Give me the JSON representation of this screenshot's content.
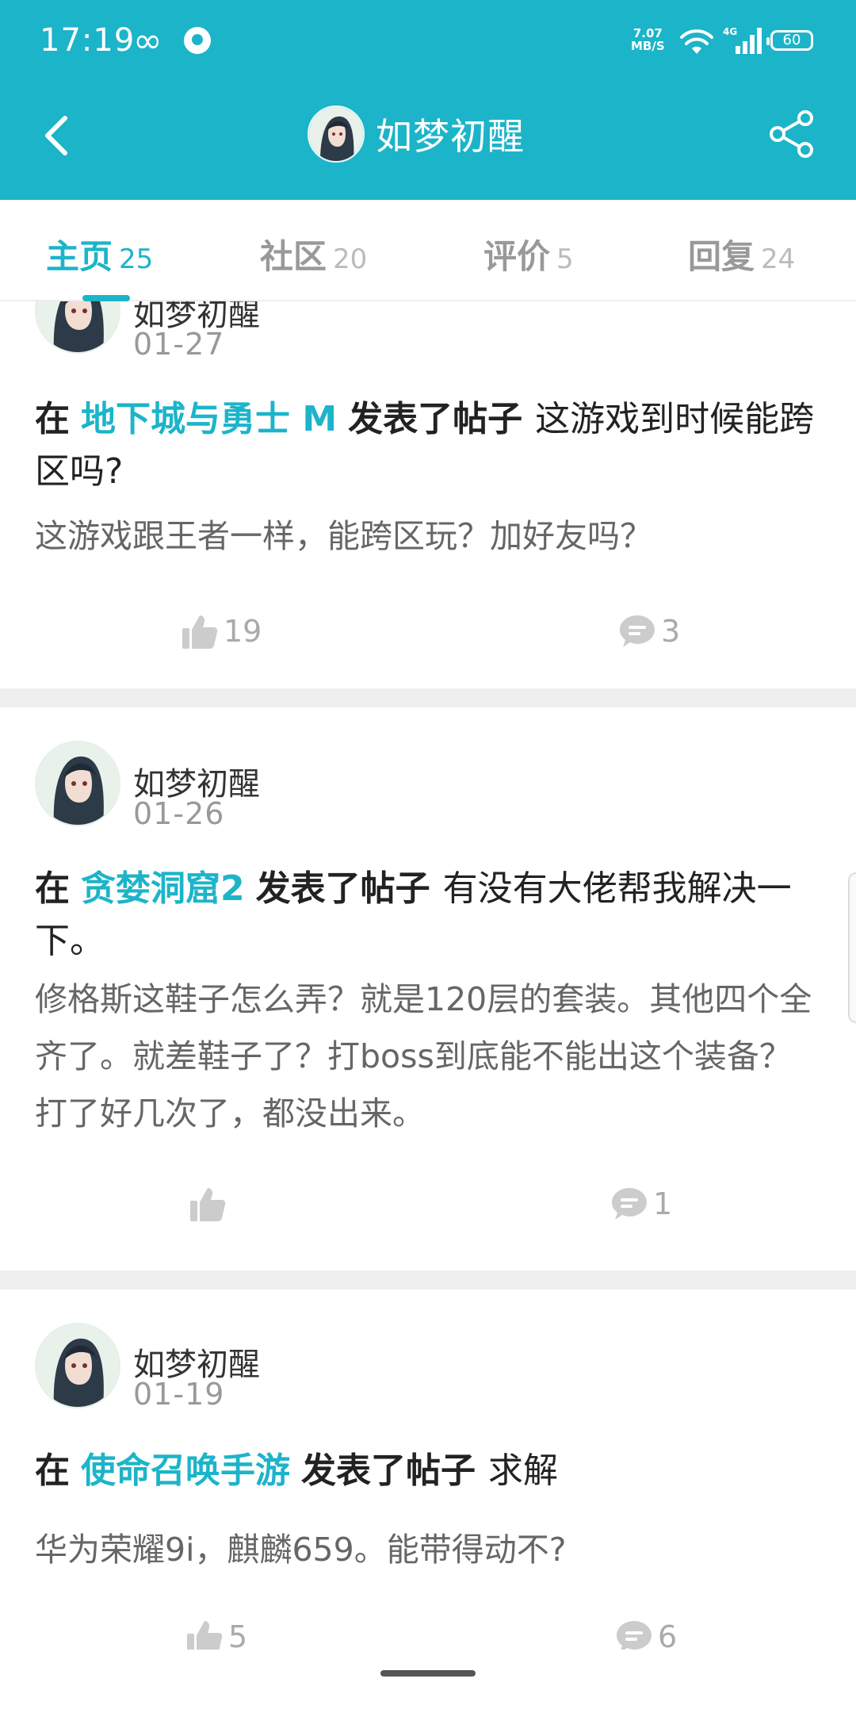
{
  "status_bar": {
    "time": "17:19",
    "net_speed_value": "7.07",
    "net_speed_unit": "MB/S",
    "network_type": "4G",
    "battery": "60"
  },
  "header": {
    "title": "如梦初醒",
    "back_icon": "chevron-left-icon",
    "share_icon": "share-icon"
  },
  "tabs": [
    {
      "label": "主页",
      "count": "25",
      "active": true
    },
    {
      "label": "社区",
      "count": "20",
      "active": false
    },
    {
      "label": "评价",
      "count": "5",
      "active": false
    },
    {
      "label": "回复",
      "count": "24",
      "active": false
    }
  ],
  "posts": [
    {
      "author": "如梦初醒",
      "date": "01-27",
      "prefix": "在",
      "game": "地下城与勇士 M",
      "action": "发表了帖子",
      "title": "这游戏到时候能跨区吗?",
      "excerpt": "这游戏跟王者一样，能跨区玩？加好友吗？",
      "likes": "19",
      "comments": "3"
    },
    {
      "author": "如梦初醒",
      "date": "01-26",
      "prefix": "在",
      "game": "贪婪洞窟2",
      "action": "发表了帖子",
      "title": "有没有大佬帮我解决一下。",
      "excerpt": "修格斯这鞋子怎么弄？就是120层的套装。其他四个全齐了。就差鞋子了？打boss到底能不能出这个装备？打了好几次了，都没出来。",
      "likes": "",
      "comments": "1"
    },
    {
      "author": "如梦初醒",
      "date": "01-19",
      "prefix": "在",
      "game": "使命召唤手游",
      "action": "发表了帖子",
      "title": "求解",
      "excerpt": "华为荣耀9i，麒麟659。能带得动不?",
      "likes": "5",
      "comments": "6"
    }
  ],
  "colors": {
    "accent": "#1cb4c9",
    "text_primary": "#222222",
    "text_secondary": "#666666",
    "text_muted": "#999999",
    "separator": "#efefef"
  }
}
